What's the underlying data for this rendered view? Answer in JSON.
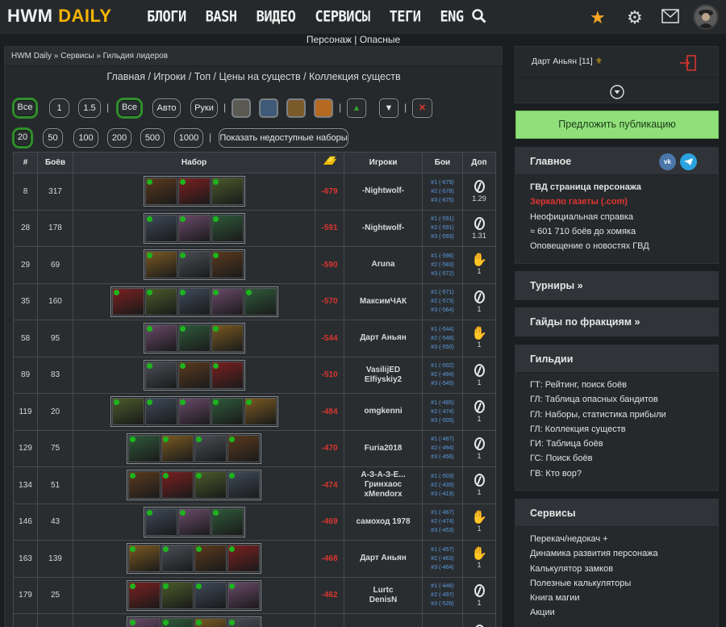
{
  "header": {
    "logo_a": "HWM ",
    "logo_b": "DAILY",
    "nav": [
      "БЛОГИ",
      "BASH",
      "ВИДЕО",
      "СЕРВИСЫ",
      "ТЕГИ",
      "ENG"
    ]
  },
  "subnav": "Персонаж | Опасные",
  "breadcrumb": "HWM Daily » Сервисы » Гильдия лидеров",
  "links": "Главная / Игроки / Топ / Цены на существ / Коллекция существ",
  "filters": {
    "all1": "Все",
    "one": "1",
    "onefive": "1.5",
    "all2": "Все",
    "auto": "Авто",
    "hands": "Руки",
    "up": "▲",
    "down": "▼",
    "close": "✕"
  },
  "sizes": [
    "20",
    "50",
    "100",
    "200",
    "500",
    "1000"
  ],
  "show_unavailable": "Показать недоступные наборы",
  "table": {
    "headers": [
      "#",
      "Боёв",
      "Набор",
      "",
      "Игроки",
      "Бои",
      "Доп"
    ],
    "rows": [
      {
        "n": "8",
        "b": "317",
        "c": 3,
        "v": "-679",
        "p": [
          "-Nightwolf-"
        ],
        "f": [
          "#1 (-679)",
          "#2 (-678)",
          "#3 (-675)"
        ],
        "d": "ring",
        "dv": "1.29"
      },
      {
        "n": "28",
        "b": "178",
        "c": 3,
        "v": "-591",
        "p": [
          "-Nightwolf-"
        ],
        "f": [
          "#1 (-591)",
          "#2 (-591)",
          "#3 (-593)"
        ],
        "d": "ring",
        "dv": "1.31"
      },
      {
        "n": "29",
        "b": "69",
        "c": 3,
        "v": "-590",
        "p": [
          "Aruna"
        ],
        "f": [
          "#1 (-596)",
          "#2 (-583)",
          "#3 (-572)"
        ],
        "d": "hand",
        "dv": "1"
      },
      {
        "n": "35",
        "b": "160",
        "c": 5,
        "v": "-570",
        "p": [
          "МаксимЧАК"
        ],
        "f": [
          "#1 (-571)",
          "#2 (-573)",
          "#3 (-564)"
        ],
        "d": "ring",
        "dv": "1"
      },
      {
        "n": "58",
        "b": "95",
        "c": 3,
        "v": "-544",
        "p": [
          "Дарт Аньян"
        ],
        "f": [
          "#1 (-544)",
          "#2 (-548)",
          "#3 (-550)"
        ],
        "d": "hand",
        "dv": "1"
      },
      {
        "n": "89",
        "b": "83",
        "c": 3,
        "v": "-510",
        "p": [
          "VasilijED",
          "Elfiyskiy2"
        ],
        "f": [
          "#1 (-502)",
          "#2 (-494)",
          "#3 (-545)"
        ],
        "d": "ring",
        "dv": "1"
      },
      {
        "n": "119",
        "b": "20",
        "c": 5,
        "v": "-484",
        "p": [
          "omgkenni"
        ],
        "f": [
          "#1 (-485)",
          "#2 (-474)",
          "#3 (-505)"
        ],
        "d": "ring",
        "dv": "1"
      },
      {
        "n": "129",
        "b": "75",
        "c": 4,
        "v": "-470",
        "p": [
          "Furia2018"
        ],
        "f": [
          "#1 (-467)",
          "#2 (-494)",
          "#3 (-456)"
        ],
        "d": "ring",
        "dv": "1"
      },
      {
        "n": "134",
        "b": "51",
        "c": 4,
        "v": "-474",
        "p": [
          "А-З-А-З-Е...",
          "Гринхаос",
          "xMendorx"
        ],
        "f": [
          "#1 (-503)",
          "#2 (-439)",
          "#3 (-419)"
        ],
        "d": "ring",
        "dv": "1"
      },
      {
        "n": "146",
        "b": "43",
        "c": 3,
        "v": "-469",
        "p": [
          "самоход 1978"
        ],
        "f": [
          "#1 (-467)",
          "#2 (-474)",
          "#3 (-453)"
        ],
        "d": "hand",
        "dv": "1"
      },
      {
        "n": "163",
        "b": "139",
        "c": 4,
        "v": "-468",
        "p": [
          "Дарт Аньян"
        ],
        "f": [
          "#1 (-457)",
          "#2 (-463)",
          "#3 (-464)"
        ],
        "d": "hand",
        "dv": "1"
      },
      {
        "n": "179",
        "b": "25",
        "c": 4,
        "v": "-462",
        "p": [
          "Lurtc",
          "DenisN"
        ],
        "f": [
          "#1 (-446)",
          "#2 (-497)",
          "#3 (-526)"
        ],
        "d": "ring",
        "dv": "1"
      },
      {
        "n": "",
        "b": "",
        "c": 4,
        "v": "",
        "p": [
          ""
        ],
        "f": [
          "#1 (-474)"
        ],
        "d": "ring",
        "dv": ""
      }
    ]
  },
  "user": {
    "name": "Дарт Аньян [11]"
  },
  "suggest": "Предложить публикацию",
  "block_main": {
    "title": "Главное",
    "items": [
      "ГВД страница персонажа",
      "Зеркало газеты (.com)",
      "Неофициальная справка",
      "≈ 601 710 боёв до хомяка",
      "Оповещение о новостях ГВД"
    ]
  },
  "tournaments": "Турниры »",
  "guides": "Гайды по фракциям »",
  "guilds": {
    "title": "Гильдии",
    "items": [
      "ГТ: Рейтинг, поиск боёв",
      "ГЛ: Таблица опасных бандитов",
      "ГЛ: Наборы, статистика прибыли",
      "ГЛ: Коллекция существ",
      "ГИ: Таблица боёв",
      "ГС: Поиск боёв",
      "ГВ: Кто вор?"
    ]
  },
  "services": {
    "title": "Сервисы",
    "items": [
      "Перекач/недокач +",
      "Динамика развития персонажа",
      "Калькулятор замков",
      "Полезные калькуляторы",
      "Книга магии",
      "Акции"
    ]
  },
  "colors": {
    "accent": "#8fe07a",
    "active_border": "#2f8f2a",
    "loss_red": "#d9352f",
    "link_blue": "#5b9ce0",
    "star": "#f7a623"
  }
}
